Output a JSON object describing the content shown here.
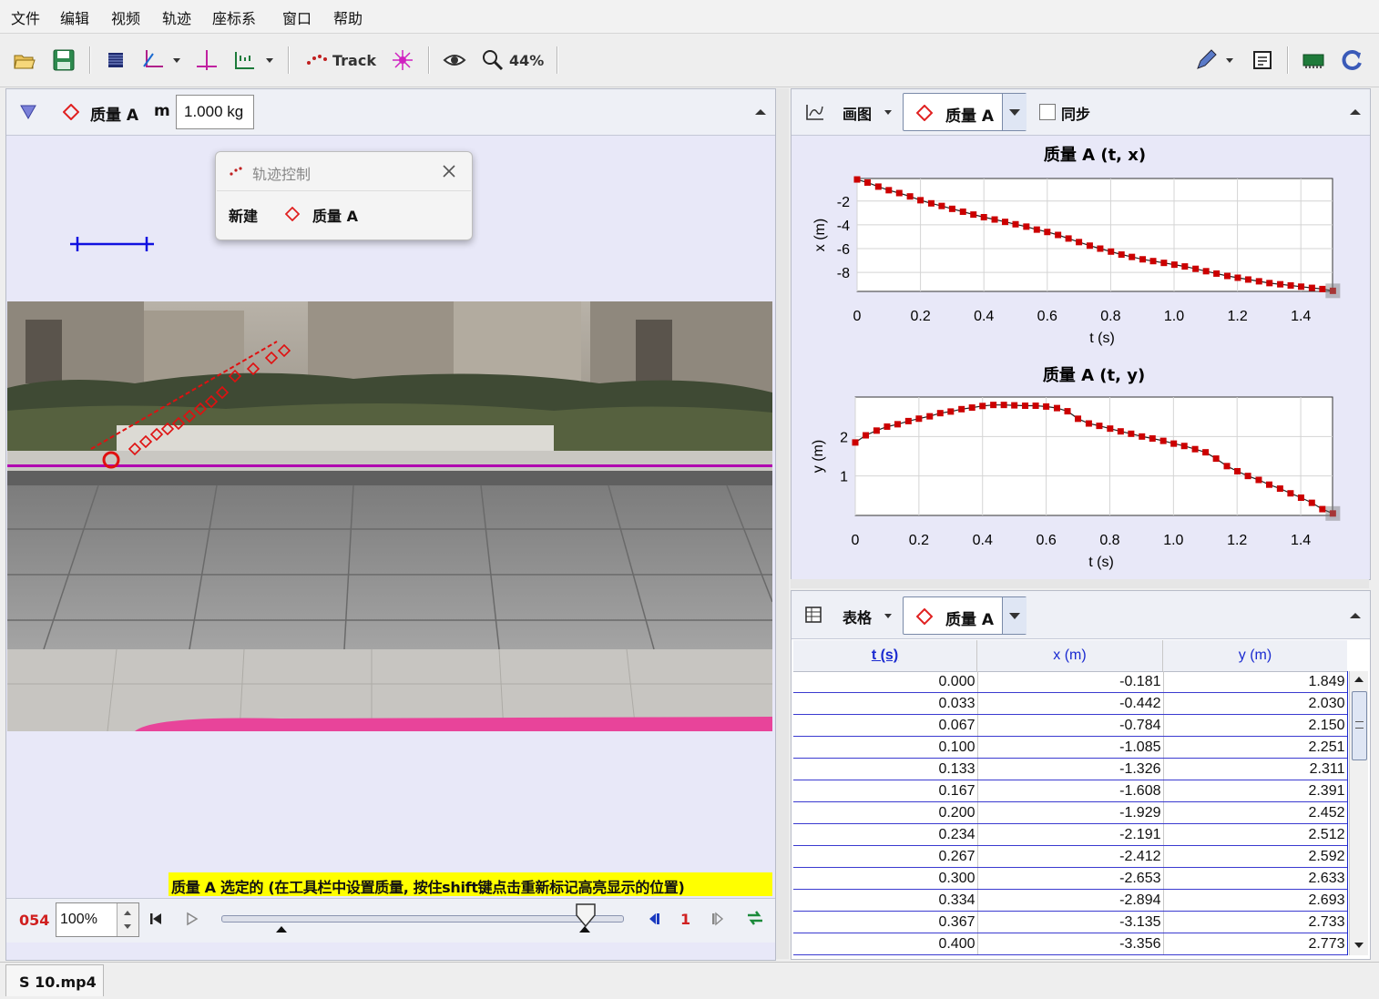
{
  "menu": [
    "文件",
    "编辑",
    "视频",
    "轨迹",
    "座标系",
    "窗口",
    "帮助"
  ],
  "toolbar": {
    "track_label": "Track",
    "zoom_label": "44%",
    "icons": [
      "open-folder-icon",
      "save-icon",
      "clip-settings-icon",
      "coord-axes-icon",
      "calibration-icon",
      "ruler-icon",
      "track-icon",
      "autotracker-icon",
      "eye-icon",
      "zoom-icon",
      "pen-icon",
      "notes-icon",
      "memory-icon",
      "refresh-icon"
    ]
  },
  "video": {
    "track_name": "质量 A",
    "mass_label": "m",
    "mass_value": "1.000 kg",
    "status_text": "质量 A 选定的 (在工具栏中设置质量, 按住shift键点击重新标记高亮显示的位置)",
    "frame_number": "054",
    "zoom_value": "100%",
    "step_size": "1",
    "tab_label": "S 10.mp4"
  },
  "track_control": {
    "title": "轨迹控制",
    "new_label": "新建",
    "track_name": "质量 A"
  },
  "plot_panel": {
    "view_label": "画图",
    "track_name": "质量 A",
    "sync_label": "同步"
  },
  "table_panel": {
    "view_label": "表格",
    "track_name": "质量 A",
    "columns": [
      "t (s)",
      "x (m)",
      "y (m)"
    ],
    "rows": [
      [
        "0.000",
        "-0.181",
        "1.849"
      ],
      [
        "0.033",
        "-0.442",
        "2.030"
      ],
      [
        "0.067",
        "-0.784",
        "2.150"
      ],
      [
        "0.100",
        "-1.085",
        "2.251"
      ],
      [
        "0.133",
        "-1.326",
        "2.311"
      ],
      [
        "0.167",
        "-1.608",
        "2.391"
      ],
      [
        "0.200",
        "-1.929",
        "2.452"
      ],
      [
        "0.234",
        "-2.191",
        "2.512"
      ],
      [
        "0.267",
        "-2.412",
        "2.592"
      ],
      [
        "0.300",
        "-2.653",
        "2.633"
      ],
      [
        "0.334",
        "-2.894",
        "2.693"
      ],
      [
        "0.367",
        "-3.135",
        "2.733"
      ],
      [
        "0.400",
        "-3.356",
        "2.773"
      ]
    ]
  },
  "chart_data": [
    {
      "type": "line",
      "title": "质量 A (t, x)",
      "xlabel": "t (s)",
      "ylabel": "x (m)",
      "xticks": [
        "0",
        "0.2",
        "0.4",
        "0.6",
        "0.8",
        "1.0",
        "1.2",
        "1.4"
      ],
      "yticks": [
        "-2",
        "-4",
        "-6",
        "-8"
      ],
      "xlim": [
        0,
        1.5
      ],
      "ylim": [
        -9.6,
        -0.1
      ],
      "grid": true,
      "color": "#cc0000",
      "x": [
        0.0,
        0.033,
        0.067,
        0.1,
        0.133,
        0.167,
        0.2,
        0.234,
        0.267,
        0.3,
        0.334,
        0.367,
        0.4,
        0.434,
        0.467,
        0.5,
        0.534,
        0.567,
        0.6,
        0.634,
        0.667,
        0.7,
        0.734,
        0.767,
        0.801,
        0.834,
        0.867,
        0.901,
        0.934,
        0.968,
        1.001,
        1.034,
        1.068,
        1.101,
        1.134,
        1.168,
        1.201,
        1.234,
        1.268,
        1.301,
        1.335,
        1.368,
        1.401,
        1.435,
        1.468,
        1.501
      ],
      "y": [
        -0.181,
        -0.442,
        -0.784,
        -1.085,
        -1.326,
        -1.608,
        -1.929,
        -2.191,
        -2.412,
        -2.653,
        -2.894,
        -3.135,
        -3.356,
        -3.55,
        -3.75,
        -3.95,
        -4.15,
        -4.4,
        -4.6,
        -4.85,
        -5.15,
        -5.45,
        -5.75,
        -6.0,
        -6.25,
        -6.5,
        -6.7,
        -6.9,
        -7.05,
        -7.2,
        -7.35,
        -7.5,
        -7.7,
        -7.9,
        -8.1,
        -8.3,
        -8.45,
        -8.6,
        -8.75,
        -8.9,
        -9.0,
        -9.1,
        -9.2,
        -9.3,
        -9.4,
        -9.55
      ]
    },
    {
      "type": "line",
      "title": "质量 A (t, y)",
      "xlabel": "t (s)",
      "ylabel": "y (m)",
      "xticks": [
        "0",
        "0.2",
        "0.4",
        "0.6",
        "0.8",
        "1.0",
        "1.2",
        "1.4"
      ],
      "yticks": [
        "2",
        "1"
      ],
      "xlim": [
        0,
        1.5
      ],
      "ylim": [
        0.0,
        3.0
      ],
      "grid": true,
      "color": "#cc0000",
      "x": [
        0.0,
        0.033,
        0.067,
        0.1,
        0.133,
        0.167,
        0.2,
        0.234,
        0.267,
        0.3,
        0.334,
        0.367,
        0.4,
        0.434,
        0.467,
        0.5,
        0.534,
        0.567,
        0.6,
        0.634,
        0.667,
        0.7,
        0.734,
        0.767,
        0.801,
        0.834,
        0.867,
        0.901,
        0.934,
        0.968,
        1.001,
        1.034,
        1.068,
        1.101,
        1.134,
        1.168,
        1.201,
        1.234,
        1.268,
        1.301,
        1.335,
        1.368,
        1.401,
        1.435,
        1.468,
        1.501
      ],
      "y": [
        1.849,
        2.03,
        2.15,
        2.251,
        2.311,
        2.391,
        2.452,
        2.512,
        2.592,
        2.633,
        2.693,
        2.733,
        2.773,
        2.8,
        2.8,
        2.79,
        2.78,
        2.78,
        2.76,
        2.72,
        2.64,
        2.45,
        2.33,
        2.27,
        2.2,
        2.13,
        2.07,
        2.0,
        1.95,
        1.89,
        1.82,
        1.76,
        1.68,
        1.6,
        1.44,
        1.25,
        1.12,
        1.0,
        0.9,
        0.78,
        0.68,
        0.56,
        0.45,
        0.32,
        0.16,
        0.05
      ]
    }
  ]
}
